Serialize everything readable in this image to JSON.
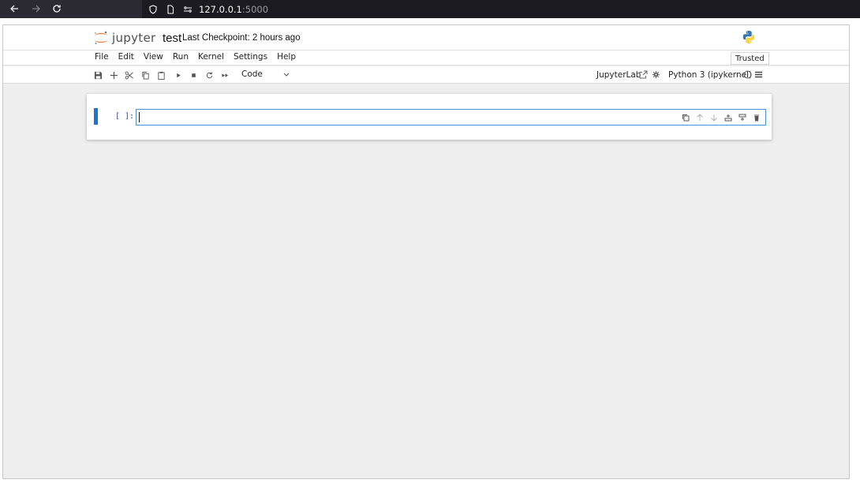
{
  "browser": {
    "url_host": "127.0.0.1",
    "url_port": ":5000"
  },
  "header": {
    "logo_text": "jupyter",
    "notebook_title": "test",
    "checkpoint": "Last Checkpoint: 2 hours ago"
  },
  "menubar": {
    "items": [
      "File",
      "Edit",
      "View",
      "Run",
      "Kernel",
      "Settings",
      "Help"
    ],
    "trusted": "Trusted"
  },
  "toolbar": {
    "cell_type": "Code",
    "jupyterlab_label": "JupyterLab",
    "kernel_name": "Python 3 (ipykernel)"
  },
  "cell": {
    "prompt": "[ ]:",
    "source": ""
  },
  "colors": {
    "accent": "#1976d2",
    "cell_border": "#4a90d9",
    "prompt": "#303f9f"
  }
}
